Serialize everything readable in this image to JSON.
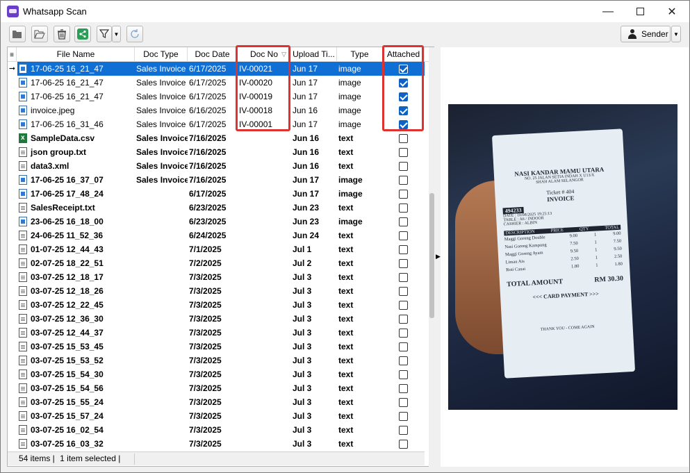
{
  "window": {
    "title": "Whatsapp Scan"
  },
  "toolbar": {
    "sender_label": "Sender"
  },
  "columns": [
    "File Name",
    "Doc Type",
    "Doc Date",
    "Doc No",
    "Upload Ti...",
    "Type",
    "Attached"
  ],
  "rows": [
    {
      "file": "17-06-25 16_21_47",
      "icon": "image",
      "doc_type": "Sales Invoice",
      "doc_date": "6/17/2025",
      "doc_no": "IV-00021",
      "upload": "Jun 17",
      "type": "image",
      "attached": true,
      "bold": false,
      "selected": true
    },
    {
      "file": "17-06-25 16_21_47",
      "icon": "image",
      "doc_type": "Sales Invoice",
      "doc_date": "6/17/2025",
      "doc_no": "IV-00020",
      "upload": "Jun 17",
      "type": "image",
      "attached": true,
      "bold": false
    },
    {
      "file": "17-06-25 16_21_47",
      "icon": "image",
      "doc_type": "Sales Invoice",
      "doc_date": "6/17/2025",
      "doc_no": "IV-00019",
      "upload": "Jun 17",
      "type": "image",
      "attached": true,
      "bold": false
    },
    {
      "file": "invoice.jpeg",
      "icon": "image",
      "doc_type": "Sales Invoice",
      "doc_date": "6/16/2025",
      "doc_no": "IV-00018",
      "upload": "Jun 16",
      "type": "image",
      "attached": true,
      "bold": false
    },
    {
      "file": "17-06-25 16_31_46",
      "icon": "image",
      "doc_type": "Sales Invoice",
      "doc_date": "6/17/2025",
      "doc_no": "IV-00001",
      "upload": "Jun 17",
      "type": "image",
      "attached": true,
      "bold": false
    },
    {
      "file": "SampleData.csv",
      "icon": "csv",
      "doc_type": "Sales Invoice",
      "doc_date": "7/16/2025",
      "doc_no": "",
      "upload": "Jun 16",
      "type": "text",
      "attached": false,
      "bold": true
    },
    {
      "file": "json group.txt",
      "icon": "text",
      "doc_type": "Sales Invoice",
      "doc_date": "7/16/2025",
      "doc_no": "",
      "upload": "Jun 16",
      "type": "text",
      "attached": false,
      "bold": true
    },
    {
      "file": "data3.xml",
      "icon": "text",
      "doc_type": "Sales Invoice",
      "doc_date": "7/16/2025",
      "doc_no": "",
      "upload": "Jun 16",
      "type": "text",
      "attached": false,
      "bold": true
    },
    {
      "file": "17-06-25 16_37_07",
      "icon": "image",
      "doc_type": "Sales Invoice",
      "doc_date": "7/16/2025",
      "doc_no": "",
      "upload": "Jun 17",
      "type": "image",
      "attached": false,
      "bold": true
    },
    {
      "file": "17-06-25 17_48_24",
      "icon": "image",
      "doc_type": "",
      "doc_date": "6/17/2025",
      "doc_no": "",
      "upload": "Jun 17",
      "type": "image",
      "attached": false,
      "bold": true
    },
    {
      "file": "SalesReceipt.txt",
      "icon": "text",
      "doc_type": "",
      "doc_date": "6/23/2025",
      "doc_no": "",
      "upload": "Jun 23",
      "type": "text",
      "attached": false,
      "bold": true
    },
    {
      "file": "23-06-25 16_18_00",
      "icon": "image",
      "doc_type": "",
      "doc_date": "6/23/2025",
      "doc_no": "",
      "upload": "Jun 23",
      "type": "image",
      "attached": false,
      "bold": true
    },
    {
      "file": "24-06-25 11_52_36",
      "icon": "text",
      "doc_type": "",
      "doc_date": "6/24/2025",
      "doc_no": "",
      "upload": "Jun 24",
      "type": "text",
      "attached": false,
      "bold": true
    },
    {
      "file": "01-07-25 12_44_43",
      "icon": "text",
      "doc_type": "",
      "doc_date": "7/1/2025",
      "doc_no": "",
      "upload": "Jul 1",
      "type": "text",
      "attached": false,
      "bold": true
    },
    {
      "file": "02-07-25 18_22_51",
      "icon": "text",
      "doc_type": "",
      "doc_date": "7/2/2025",
      "doc_no": "",
      "upload": "Jul 2",
      "type": "text",
      "attached": false,
      "bold": true
    },
    {
      "file": "03-07-25 12_18_17",
      "icon": "text",
      "doc_type": "",
      "doc_date": "7/3/2025",
      "doc_no": "",
      "upload": "Jul 3",
      "type": "text",
      "attached": false,
      "bold": true
    },
    {
      "file": "03-07-25 12_18_26",
      "icon": "text",
      "doc_type": "",
      "doc_date": "7/3/2025",
      "doc_no": "",
      "upload": "Jul 3",
      "type": "text",
      "attached": false,
      "bold": true
    },
    {
      "file": "03-07-25 12_22_45",
      "icon": "text",
      "doc_type": "",
      "doc_date": "7/3/2025",
      "doc_no": "",
      "upload": "Jul 3",
      "type": "text",
      "attached": false,
      "bold": true
    },
    {
      "file": "03-07-25 12_36_30",
      "icon": "text",
      "doc_type": "",
      "doc_date": "7/3/2025",
      "doc_no": "",
      "upload": "Jul 3",
      "type": "text",
      "attached": false,
      "bold": true
    },
    {
      "file": "03-07-25 12_44_37",
      "icon": "text",
      "doc_type": "",
      "doc_date": "7/3/2025",
      "doc_no": "",
      "upload": "Jul 3",
      "type": "text",
      "attached": false,
      "bold": true
    },
    {
      "file": "03-07-25 15_53_45",
      "icon": "text",
      "doc_type": "",
      "doc_date": "7/3/2025",
      "doc_no": "",
      "upload": "Jul 3",
      "type": "text",
      "attached": false,
      "bold": true
    },
    {
      "file": "03-07-25 15_53_52",
      "icon": "text",
      "doc_type": "",
      "doc_date": "7/3/2025",
      "doc_no": "",
      "upload": "Jul 3",
      "type": "text",
      "attached": false,
      "bold": true
    },
    {
      "file": "03-07-25 15_54_30",
      "icon": "text",
      "doc_type": "",
      "doc_date": "7/3/2025",
      "doc_no": "",
      "upload": "Jul 3",
      "type": "text",
      "attached": false,
      "bold": true
    },
    {
      "file": "03-07-25 15_54_56",
      "icon": "text",
      "doc_type": "",
      "doc_date": "7/3/2025",
      "doc_no": "",
      "upload": "Jul 3",
      "type": "text",
      "attached": false,
      "bold": true
    },
    {
      "file": "03-07-25 15_55_24",
      "icon": "text",
      "doc_type": "",
      "doc_date": "7/3/2025",
      "doc_no": "",
      "upload": "Jul 3",
      "type": "text",
      "attached": false,
      "bold": true
    },
    {
      "file": "03-07-25 15_57_24",
      "icon": "text",
      "doc_type": "",
      "doc_date": "7/3/2025",
      "doc_no": "",
      "upload": "Jul 3",
      "type": "text",
      "attached": false,
      "bold": true
    },
    {
      "file": "03-07-25 16_02_54",
      "icon": "text",
      "doc_type": "",
      "doc_date": "7/3/2025",
      "doc_no": "",
      "upload": "Jul 3",
      "type": "text",
      "attached": false,
      "bold": true
    },
    {
      "file": "03-07-25 16_03_32",
      "icon": "text",
      "doc_type": "",
      "doc_date": "7/3/2025",
      "doc_no": "",
      "upload": "Jul 3",
      "type": "text",
      "attached": false,
      "bold": true
    }
  ],
  "status": {
    "items": "54 items |",
    "selected": "1 item selected |"
  },
  "receipt": {
    "shop": "NASI KANDAR MAMU UTARA",
    "addr": "NO. 25 JALAN SETIA INDAH X U13/X",
    "city": "SHAH ALAM SELANGOR",
    "ticket": "Ticket # 404",
    "heading": "INVOICE",
    "invoice_no": "494233",
    "date": "DATE : 10/08/2025 19:25:13",
    "table": "TABLE : A6 / INDOOR",
    "cashier": "CASHIER : ALBIN",
    "cols": [
      "DESCRIPTION",
      "PRICE",
      "QTY",
      "TOTAL"
    ],
    "items": [
      {
        "d": "Maggi Goreng Double",
        "p": "9.00",
        "q": "1",
        "t": "9.00"
      },
      {
        "d": "Nasi Goreng Kampung",
        "p": "7.50",
        "q": "1",
        "t": "7.50"
      },
      {
        "d": "Maggi Goreng Ayam",
        "p": "9.50",
        "q": "1",
        "t": "9.50"
      },
      {
        "d": "Limau Ais",
        "p": "2.50",
        "q": "1",
        "t": "2.50"
      },
      {
        "d": "Roti Canai",
        "p": "1.80",
        "q": "1",
        "t": "1.80"
      }
    ],
    "total_label": "TOTAL AMOUNT",
    "total": "RM 30.30",
    "payment": "<<< CARD PAYMENT >>>",
    "thanks": "THANK YOU - COME AGAIN"
  },
  "colors": {
    "selection": "#0f6fd5",
    "highlight": "#e03131",
    "checkbox": "#0f62c4"
  }
}
